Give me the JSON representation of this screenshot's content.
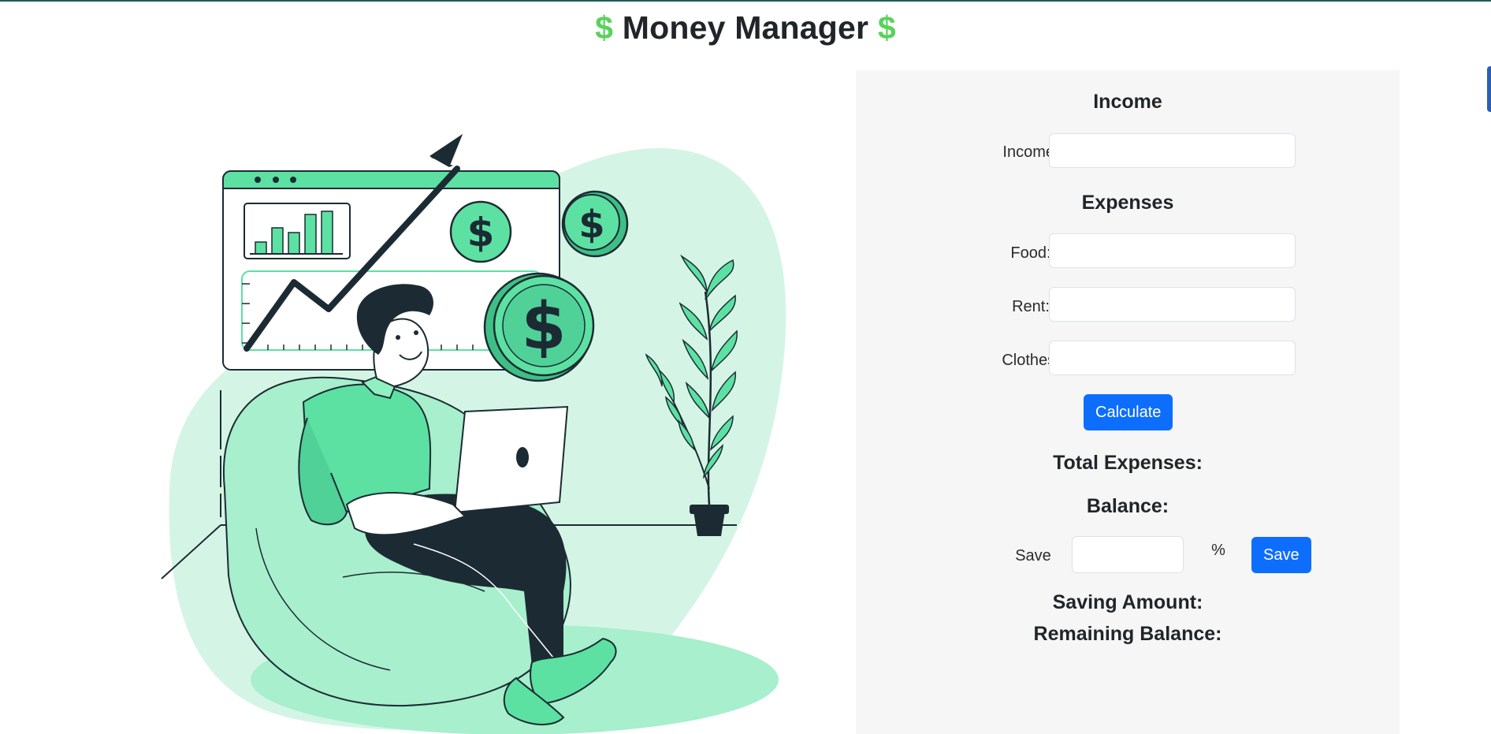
{
  "app": {
    "title": "Money Manager",
    "title_icon": "$"
  },
  "income": {
    "heading": "Income",
    "label": "Income:",
    "value": ""
  },
  "expenses": {
    "heading": "Expenses",
    "food_label": "Food:",
    "food_value": "",
    "rent_label": "Rent:",
    "rent_value": "",
    "clothes_label": "Clothes:",
    "clothes_value": ""
  },
  "actions": {
    "calculate_label": "Calculate",
    "save_label": "Save"
  },
  "results": {
    "total_expenses_label": "Total Expenses:",
    "balance_label": "Balance:",
    "saving_amount_label": "Saving Amount:",
    "remaining_balance_label": "Remaining Balance:"
  },
  "savings": {
    "label": "Save",
    "percent_value": "",
    "unit": "%"
  },
  "colors": {
    "accent_green": "#59d25b",
    "button_blue": "#0d6efd",
    "panel_bg": "#f6f6f6",
    "illustration_mint": "#d4f5e5",
    "illustration_green": "#5ce1a3",
    "illustration_dark": "#1c2b33"
  },
  "icons": [
    "dollar-icon",
    "finance-illustration"
  ]
}
